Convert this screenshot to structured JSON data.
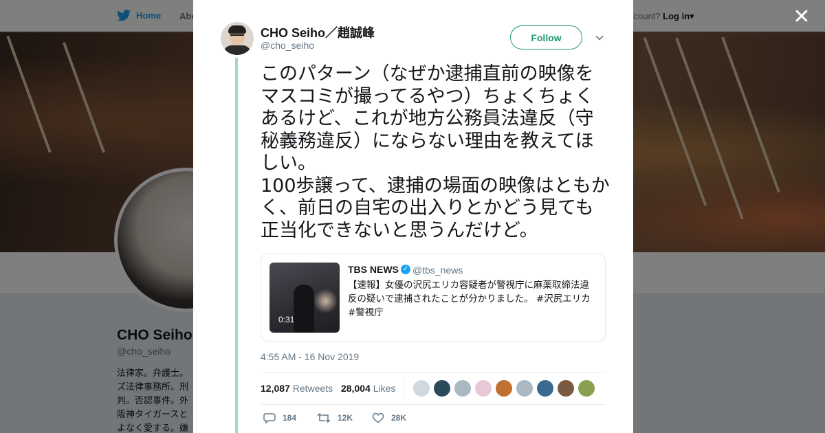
{
  "background": {
    "nav": {
      "home": "Home",
      "about": "Abo",
      "account_prompt": "ccount?",
      "login": "Log in"
    },
    "profile": {
      "name": "CHO Seiho",
      "handle": "@cho_seiho",
      "bio_lines": [
        "法律家。弁護士。",
        "ズ法律事務所。刑",
        "判。否認事件。外",
        "阪神タイガースと",
        "よなく愛する。嫌"
      ]
    }
  },
  "tweet": {
    "author_name": "CHO Seiho／趙誠峰",
    "author_handle": "@cho_seiho",
    "follow_label": "Follow",
    "text": "このパターン（なぜか逮捕直前の映像をマスコミが撮ってるやつ）ちょくちょくあるけど、これが地方公務員法違反（守秘義務違反）にならない理由を教えてほしい。\n100歩譲って、逮捕の場面の映像はともかく、前日の自宅の出入りとかどう見ても正当化できないと思うんだけど。",
    "quoted": {
      "name": "TBS NEWS",
      "handle": "@tbs_news",
      "text": "【速報】女優の沢尻エリカ容疑者が警視庁に麻薬取締法違反の疑いで逮捕されたことが分かりました。 #沢尻エリカ #警視庁",
      "video_duration": "0:31"
    },
    "timestamp": "4:55 AM - 16 Nov 2019",
    "retweets_count": "12,087",
    "retweets_label": "Retweets",
    "likes_count": "28,004",
    "likes_label": "Likes",
    "likers": [
      "#cfd9de",
      "#2b4a5a",
      "#aab8c2",
      "#e8c8d8",
      "#c07030",
      "#aab8c2",
      "#3a6a90",
      "#7a5a40",
      "#8aa050"
    ],
    "reply_count": "184",
    "retweet_count_short": "12K",
    "like_count_short": "28K"
  },
  "colors": {
    "accent": "#1d9a6c",
    "thread": "#9fdcbf",
    "link": "#1da1f2"
  }
}
